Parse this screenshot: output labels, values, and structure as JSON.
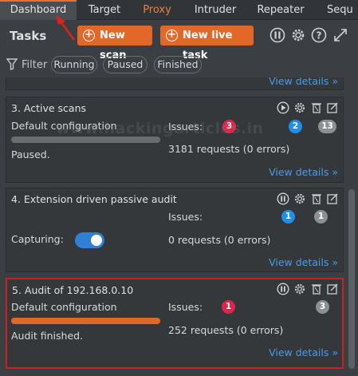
{
  "tabs": [
    "Dashboard",
    "Target",
    "Proxy",
    "Intruder",
    "Repeater",
    "Sequ"
  ],
  "header": {
    "title": "Tasks",
    "new_scan": "New scan",
    "new_live_task": "New live task"
  },
  "filter": {
    "label": "Filter",
    "chips": [
      "Running",
      "Paused",
      "Finished"
    ]
  },
  "view_details": "View details »",
  "watermark": "www.hackingarticles.in",
  "tasks": [
    {
      "title": "3. Active scans",
      "config": "Default configuration",
      "progress": 0.0,
      "status": "Paused.",
      "issues_label": "Issues:",
      "issues": {
        "high": "3",
        "medium": "2",
        "info": "13"
      },
      "requests": "3181 requests (0 errors)"
    },
    {
      "title": "4. Extension driven passive audit",
      "issues_label": "Issues:",
      "capture_label": "Capturing:",
      "capturing": true,
      "issues": {
        "medium": "1",
        "info": "1"
      },
      "requests": "0 requests (0 errors)"
    },
    {
      "title": "5. Audit of 192.168.0.10",
      "config": "Default configuration",
      "progress": 1.0,
      "status": "Audit finished.",
      "issues_label": "Issues:",
      "issues": {
        "high": "1",
        "info": "3"
      },
      "requests": "252 requests (0 errors)"
    }
  ],
  "colors": {
    "accent": "#e2682a",
    "high": "#e0254a",
    "medium": "#1f8fe8",
    "info": "#8c9094",
    "link": "#4a9be8"
  }
}
